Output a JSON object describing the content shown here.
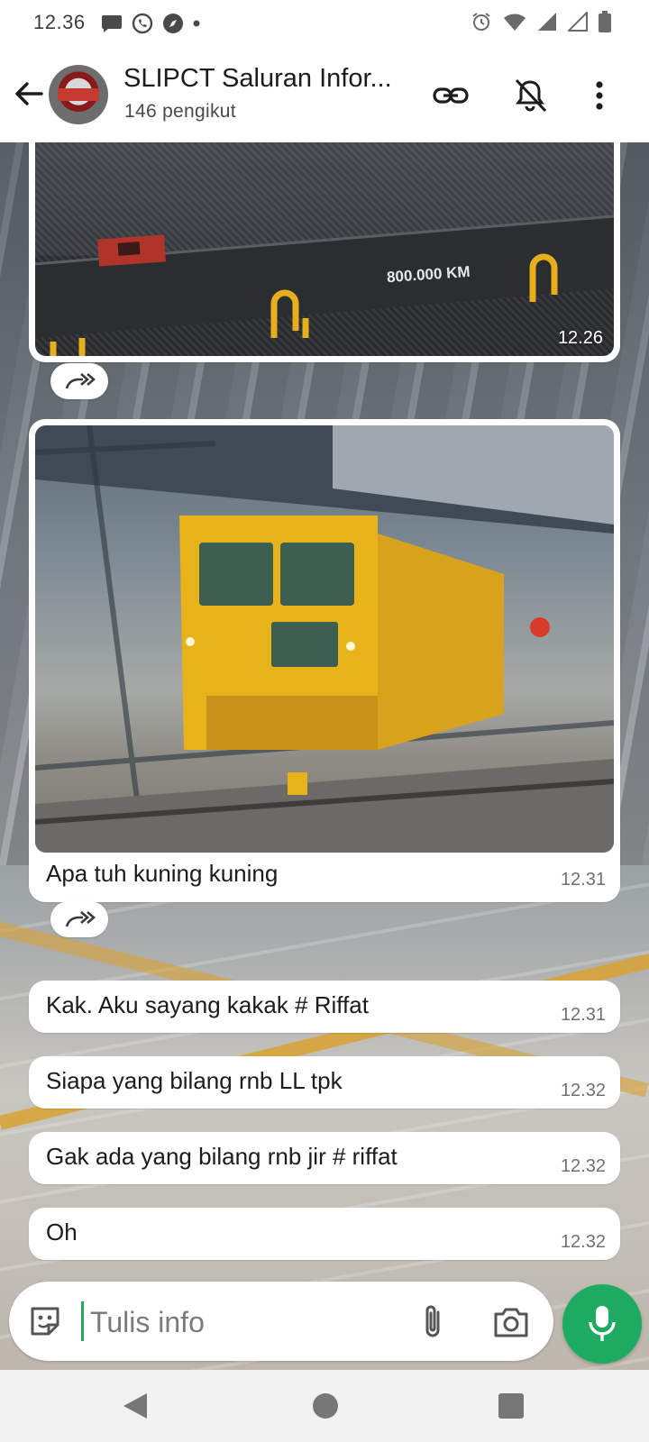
{
  "status_bar": {
    "time": "12.36",
    "left_icons": [
      "chat-bubble-icon",
      "whatsapp-icon",
      "compass-icon",
      "dot-icon"
    ],
    "right_icons": [
      "alarm-icon",
      "wifi-icon",
      "signal-icon",
      "signal-icon",
      "battery-icon"
    ]
  },
  "header": {
    "title": "SLIPCT Saluran Infor...",
    "subtitle": "146 pengikut",
    "icons": [
      "back-arrow-icon",
      "link-icon",
      "bell-off-icon",
      "more-vert-icon"
    ]
  },
  "messages": [
    {
      "type": "image",
      "photo": "flatcar-800000-km",
      "photo_text": "800.000 KM",
      "time": "12.26"
    },
    {
      "type": "image",
      "photo": "yellow-rail-maintenance-train",
      "caption": "Apa tuh kuning kuning",
      "time": "12.31"
    },
    {
      "type": "text",
      "text": "Kak. Aku sayang kakak # Riffat",
      "time": "12.31"
    },
    {
      "type": "text",
      "text": "Siapa yang bilang rnb LL tpk",
      "time": "12.32"
    },
    {
      "type": "text",
      "text": "Gak ada yang bilang rnb jir # riffat",
      "time": "12.32"
    },
    {
      "type": "text",
      "text": "Oh",
      "time": "12.32"
    }
  ],
  "composer": {
    "placeholder": "Tulis info",
    "icons": [
      "sticker-icon",
      "attach-icon",
      "camera-icon",
      "mic-icon"
    ]
  },
  "colors": {
    "accent_green": "#1daa61",
    "cursor_green": "#25a85c",
    "bubble": "#ffffff"
  }
}
